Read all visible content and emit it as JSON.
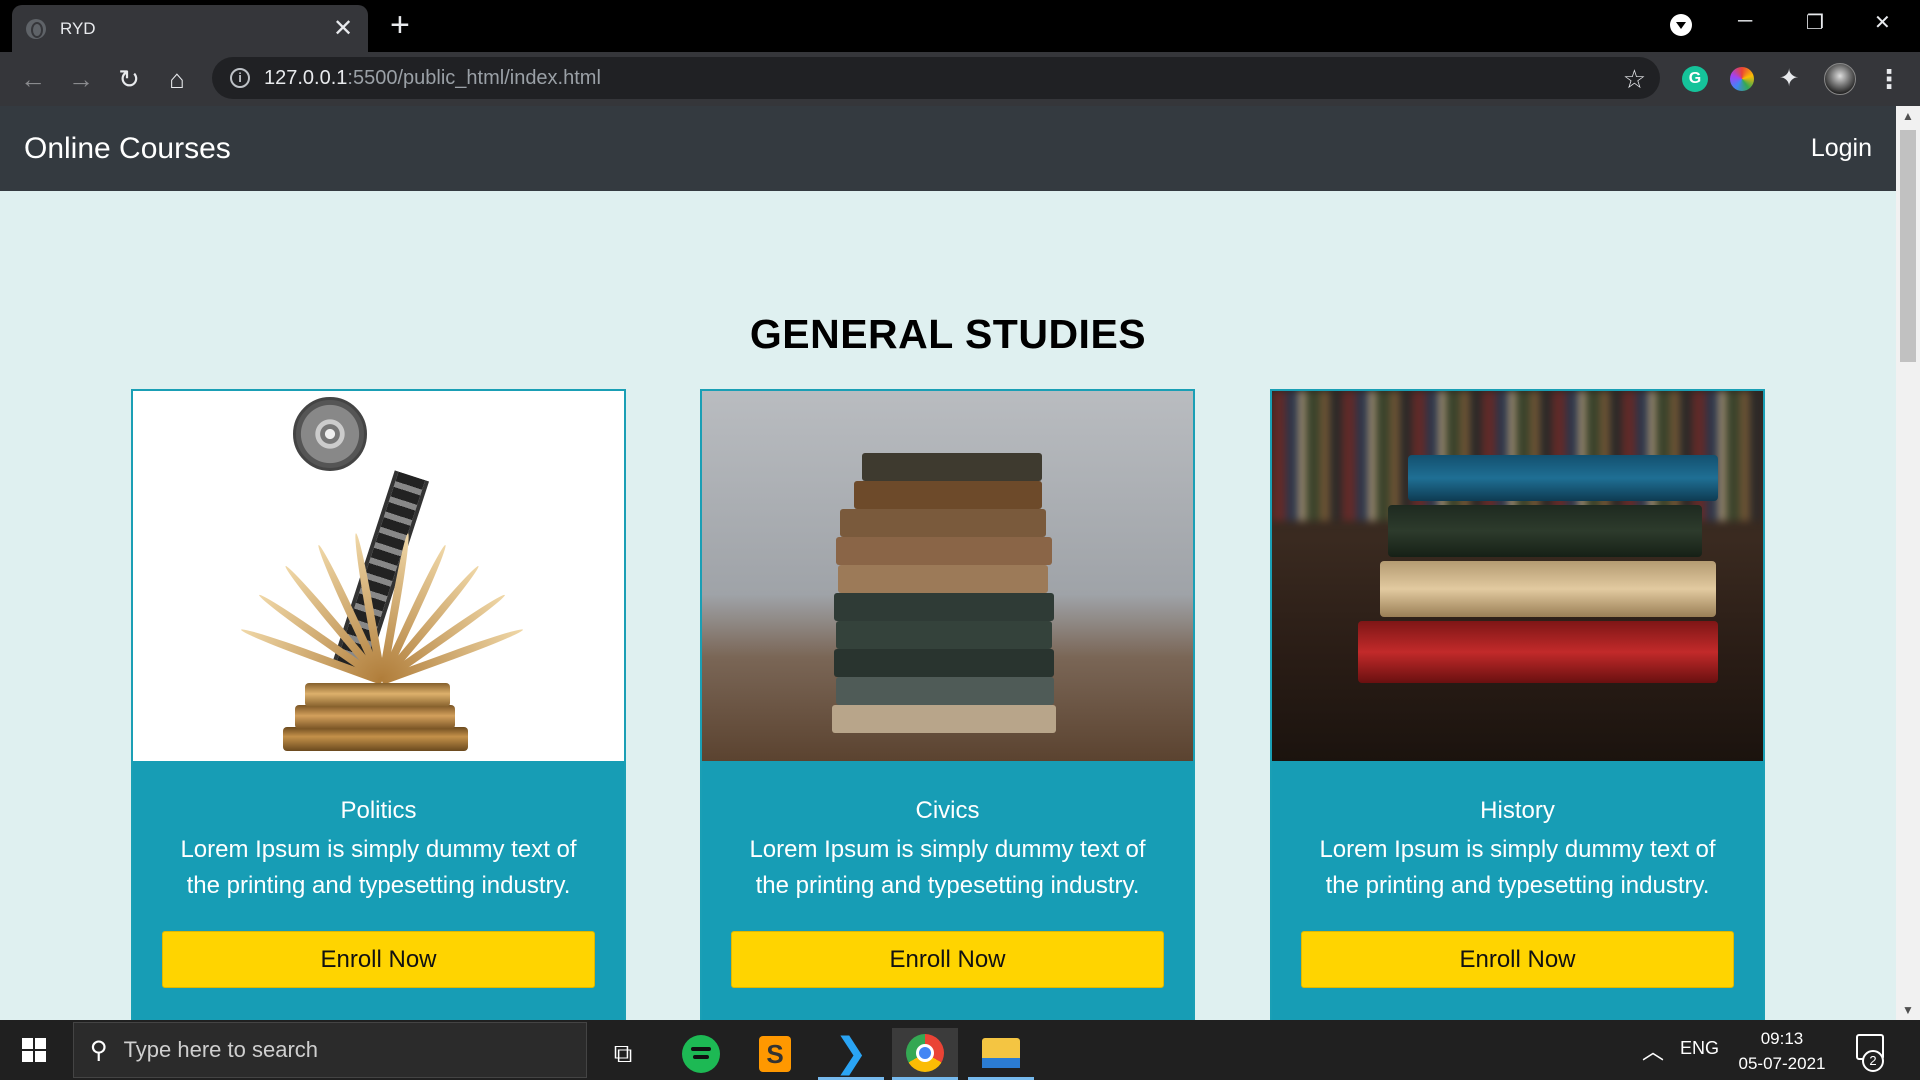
{
  "browser": {
    "tab_title": "RYD",
    "url_host": "127.0.0.1",
    "url_rest": ":5500/public_html/index.html"
  },
  "site": {
    "brand": "Online Courses",
    "login": "Login",
    "heading": "GENERAL STUDIES",
    "courses": [
      {
        "title": "Politics",
        "description": "Lorem Ipsum is simply dummy text of the printing and typesetting industry.",
        "button": "Enroll Now",
        "image": "open-book-film-reel"
      },
      {
        "title": "Civics",
        "description": "Lorem Ipsum is simply dummy text of the printing and typesetting industry.",
        "button": "Enroll Now",
        "image": "stacked-old-books"
      },
      {
        "title": "History",
        "description": "Lorem Ipsum is simply dummy text of the printing and typesetting industry.",
        "button": "Enroll Now",
        "image": "colored-books-library"
      }
    ]
  },
  "taskbar": {
    "search_placeholder": "Type here to search",
    "language": "ENG",
    "time": "09:13",
    "date": "05-07-2021",
    "notification_count": "2"
  },
  "colors": {
    "navbar": "#343a40",
    "page_background": "#dff0f0",
    "card": "#179db5",
    "button": "#ffd400"
  }
}
